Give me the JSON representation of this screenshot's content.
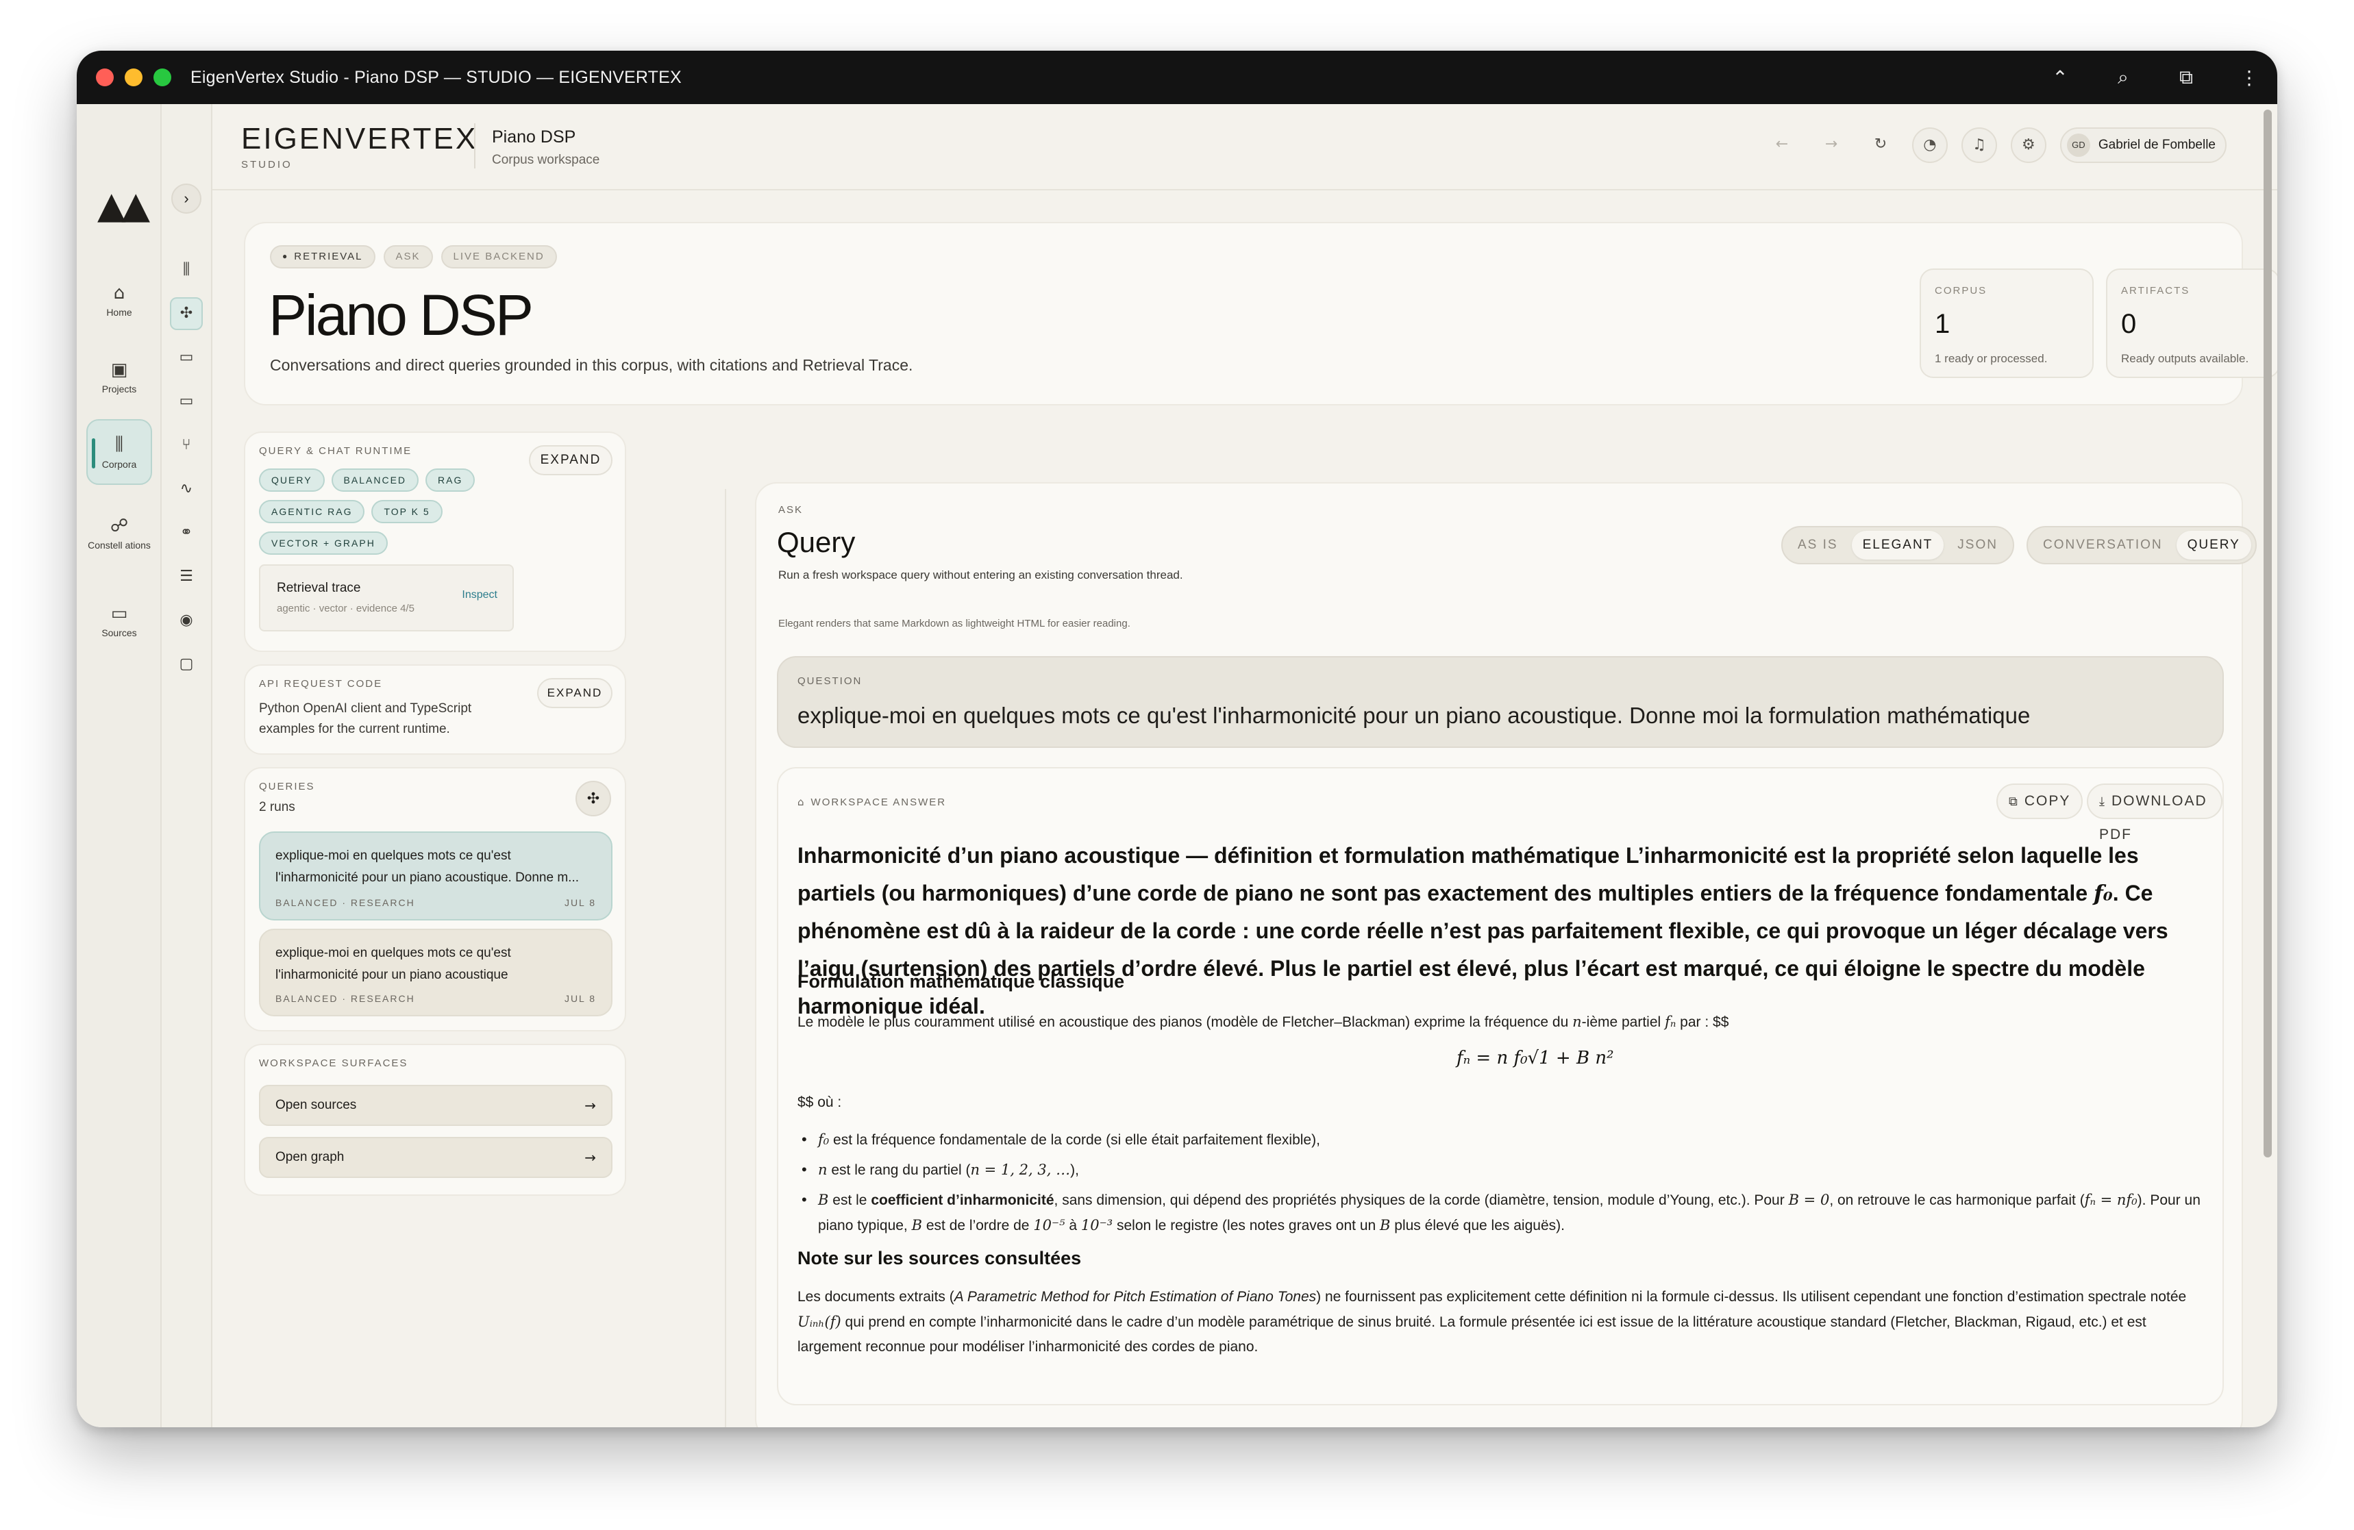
{
  "window": {
    "title": "EigenVertex Studio - Piano DSP — STUDIO — EIGENVERTEX",
    "controls": [
      "chevron-up-icon",
      "search-icon",
      "extension-icon",
      "more-vertical-icon"
    ]
  },
  "rail": {
    "items": [
      {
        "label": "Home",
        "icon": "⌂"
      },
      {
        "label": "Projects",
        "icon": "▣"
      },
      {
        "label": "Corpora",
        "icon": "⫼"
      },
      {
        "label": "Constell ations",
        "icon": "☍"
      },
      {
        "label": "Sources",
        "icon": "▭"
      }
    ]
  },
  "subrail": {
    "toggle": "›",
    "icons": [
      "⫼",
      "✣",
      "▭",
      "▭",
      "⑂",
      "∿",
      "⚭",
      "☰",
      "◉",
      "▢"
    ]
  },
  "header": {
    "brand": "EIGENVERTEX",
    "brand_sub": "STUDIO",
    "workspace_title": "Piano DSP",
    "workspace_sub": "Corpus workspace",
    "user_initials": "GD",
    "user_name": "Gabriel de Fombelle",
    "buttons": [
      "←",
      "→",
      "↻",
      "◔",
      "♫",
      "⚙"
    ]
  },
  "hero": {
    "pills": [
      "RETRIEVAL",
      "ASK",
      "LIVE BACKEND"
    ],
    "title": "Piano DSP",
    "description": "Conversations and direct queries grounded in this corpus, with citations and Retrieval Trace.",
    "stats": [
      {
        "label": "CORPUS",
        "value": "1",
        "note": "1 ready or processed."
      },
      {
        "label": "ARTIFACTS",
        "value": "0",
        "note": "Ready outputs available."
      }
    ]
  },
  "runtime": {
    "label": "QUERY & CHAT RUNTIME",
    "expand": "EXPAND",
    "chips": [
      "QUERY",
      "BALANCED",
      "RAG",
      "AGENTIC RAG",
      "TOP K 5",
      "VECTOR + GRAPH"
    ],
    "trace_title": "Retrieval trace",
    "trace_sub": "agentic · vector · evidence 4/5",
    "trace_link": "Inspect"
  },
  "api": {
    "label": "API REQUEST CODE",
    "expand": "EXPAND",
    "description": "Python OpenAI client and TypeScript examples for the current runtime."
  },
  "queries": {
    "label": "QUERIES",
    "count": "2 runs",
    "runs": [
      {
        "text": "explique-moi en quelques mots ce qu'est l'inharmonicité pour un piano acoustique. Donne m...",
        "meta": "BALANCED · RESEARCH",
        "date": "JUL 8"
      },
      {
        "text": "explique-moi en quelques mots ce qu'est l'inharmonicité pour un piano acoustique",
        "meta": "BALANCED · RESEARCH",
        "date": "JUL 8"
      }
    ]
  },
  "surfaces": {
    "label": "WORKSPACE SURFACES",
    "items": [
      "Open sources",
      "Open graph"
    ]
  },
  "main": {
    "ask_label": "ASK",
    "title": "Query",
    "subtitle": "Run a fresh workspace query without entering an existing conversation thread.",
    "note": "Elegant renders that same Markdown as lightweight HTML for easier reading.",
    "format_options": [
      "AS IS",
      "ELEGANT",
      "JSON"
    ],
    "format_selected": "ELEGANT",
    "mode_options": [
      "CONVERSATION",
      "QUERY"
    ],
    "mode_selected": "QUERY",
    "question_label": "QUESTION",
    "question": "explique-moi en quelques mots ce qu'est l'inharmonicité pour un piano acoustique. Donne moi la formulation mathématique",
    "answer_label": "WORKSPACE ANSWER",
    "copy": "COPY",
    "download": "DOWNLOAD PDF"
  },
  "answer": {
    "intro_a": "Inharmonicité d’un piano acoustique — définition et formulation mathématique L’inharmonicité est la propriété selon laquelle les partiels (ou harmoniques) d’une corde de piano ne sont pas exactement des multiples entiers de la fréquence fondamentale ",
    "intro_math": "f₀",
    "intro_b": ". Ce phénomène est dû à la raideur de la corde : une corde réelle n’est pas parfaitement flexible, ce qui provoque un léger décalage vers l’aigu (surtension) des partiels d’ordre élevé. Plus le partiel est élevé, plus l’écart est marqué, ce qui éloigne le spectre du modèle harmonique idéal.",
    "h_formula": "Formulation mathématique classique",
    "p_model_a": "Le modèle le plus couramment utilisé en acoustique des pianos (modèle de Fletcher–Blackman) exprime la fréquence du ",
    "p_model_n": "n",
    "p_model_b": "-ième partiel ",
    "p_model_fn": "fₙ",
    "p_model_c": " par : $$",
    "formula": "fₙ = n f₀√1 + B n²",
    "where": "$$ où :",
    "b1_math": "f₀",
    "b1_text": " est la fréquence fondamentale de la corde (si elle était parfaitement flexible),",
    "b2_math": "n",
    "b2_text": " est le rang du partiel (",
    "b2_range": "n = 1, 2, 3, …",
    "b2_end": "),",
    "b3_math": "B",
    "b3_a": " est le ",
    "b3_bold": "coefficient d’inharmonicité",
    "b3_b": ", sans dimension, qui dépend des propriétés physiques de la corde (diamètre, tension, module d’Young, etc.). Pour ",
    "b3_b0": "B = 0",
    "b3_c": ", on retrouve le cas harmonique parfait (",
    "b3_fn": "fₙ = nf₀",
    "b3_d": "). Pour un piano typique, ",
    "b3_B": "B",
    "b3_e": " est de l’ordre de ",
    "b3_r1": "10⁻⁵",
    "b3_f": " à ",
    "b3_r2": "10⁻³",
    "b3_g": " selon le registre (les notes graves ont un ",
    "b3_B2": "B",
    "b3_h": " plus élevé que les aiguës).",
    "h_sources": "Note sur les sources consultées",
    "p_src_a": "Les documents extraits (",
    "p_src_title": "A Parametric Method for Pitch Estimation of Piano Tones",
    "p_src_b": ") ne fournissent pas explicitement cette définition ni la formule ci-dessus. Ils utilisent cependant une fonction d’estimation spectrale notée ",
    "p_src_math": "Uᵢₙₕ(f)",
    "p_src_c": " qui prend en compte l’inharmonicité dans le cadre d’un modèle paramétrique de sinus bruité. La formule présentée ici est issue de la littérature acoustique standard (Fletcher, Blackman, Rigaud, etc.) et est largement reconnue pour modéliser l’inharmonicité des cordes de piano."
  }
}
